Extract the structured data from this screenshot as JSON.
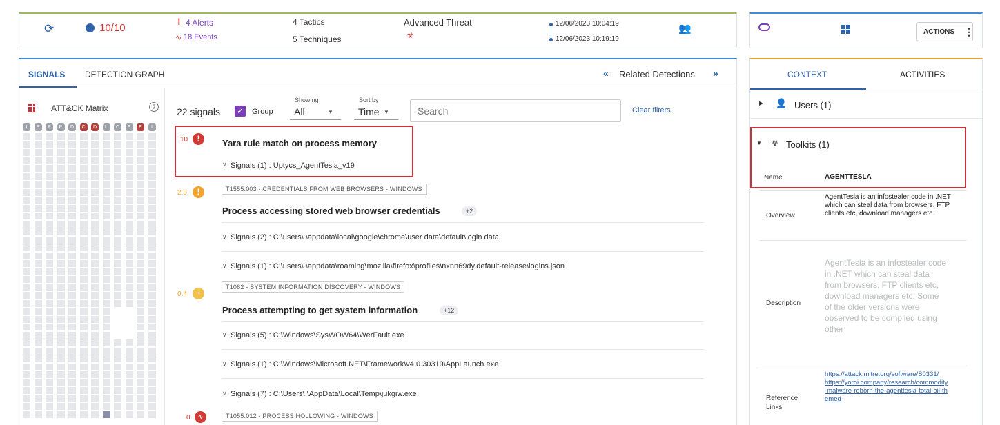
{
  "header": {
    "score": "10/10",
    "alerts": "4 Alerts",
    "events": "18 Events",
    "tactics": "4 Tactics",
    "techniques": "5 Techniques",
    "threat": "Advanced Threat",
    "time_start": "12/06/2023 10:04:19",
    "time_end": "12/06/2023 10:19:19",
    "actions_label": "ACTIONS"
  },
  "tabs": {
    "signals": "SIGNALS",
    "detection_graph": "DETECTION GRAPH",
    "related": "Related Detections"
  },
  "matrix": {
    "title": "ATT&CK Matrix",
    "tactic_letters": [
      "I",
      "E",
      "P",
      "P",
      "D",
      "C",
      "D",
      "L",
      "C",
      "E",
      "E",
      "I"
    ],
    "red_columns": [
      5,
      6,
      10
    ]
  },
  "filters": {
    "count": "22 signals",
    "group_label": "Group",
    "showing_label": "Showing",
    "showing_value": "All",
    "sortby_label": "Sort by",
    "sortby_value": "Time",
    "search_placeholder": "Search",
    "clear": "Clear filters"
  },
  "signals": [
    {
      "score": "10",
      "color": "#d13a35",
      "title": "Yara rule match on process memory",
      "lines": [
        "Signals (1) : Uptycs_AgentTesla_v19"
      ]
    },
    {
      "score": "2.0",
      "color": "#f0a431",
      "chip": "T1555.003 - CREDENTIALS FROM WEB BROWSERS - WINDOWS",
      "title": "Process accessing stored web browser credentials",
      "plus": "+2",
      "lines": [
        "Signals (2) : C:\\users\\        \\appdata\\local\\google\\chrome\\user data\\default\\login data",
        "Signals (1) : C:\\users\\        \\appdata\\roaming\\mozilla\\firefox\\profiles\\nxnn69dy.default-release\\logins.json"
      ]
    },
    {
      "score": "0.4",
      "color": "#f2c04c",
      "chip": "T1082 - SYSTEM INFORMATION DISCOVERY - WINDOWS",
      "title": "Process attempting to get system information",
      "plus": "+12",
      "lines": [
        "Signals (5) : C:\\Windows\\SysWOW64\\WerFault.exe",
        "Signals (1) : C:\\Windows\\Microsoft.NET\\Framework\\v4.0.30319\\AppLaunch.exe",
        "Signals (7) : C:\\Users\\        \\AppData\\Local\\Temp\\jukgiw.exe"
      ]
    },
    {
      "score": "0",
      "color": "#d13a35",
      "chip": "T1055.012 - PROCESS HOLLOWING - WINDOWS"
    }
  ],
  "side": {
    "tab_context": "CONTEXT",
    "tab_activities": "ACTIVITIES",
    "users": "Users (1)",
    "toolkits": "Toolkits (1)",
    "name_label": "Name",
    "name_value": "AGENTTESLA",
    "overview_label": "Overview",
    "overview_value": "AgentTesla is an infostealer code in .NET which can steal data from browsers, FTP clients etc, download managers etc.",
    "description_label": "Description",
    "description_value": "AgentTesla is an infostealer code in .NET which can steal data from browsers, FTP clients etc, download managers etc. Some of the older versions were observed to be compiled using other",
    "links_label": "Reference Links",
    "link1": "https://attack.mitre.org/software/S0331/",
    "link2": "https://yoroi.company/research/commodity-malware-reborn-the-agenttesla-total-oil-themed-"
  }
}
